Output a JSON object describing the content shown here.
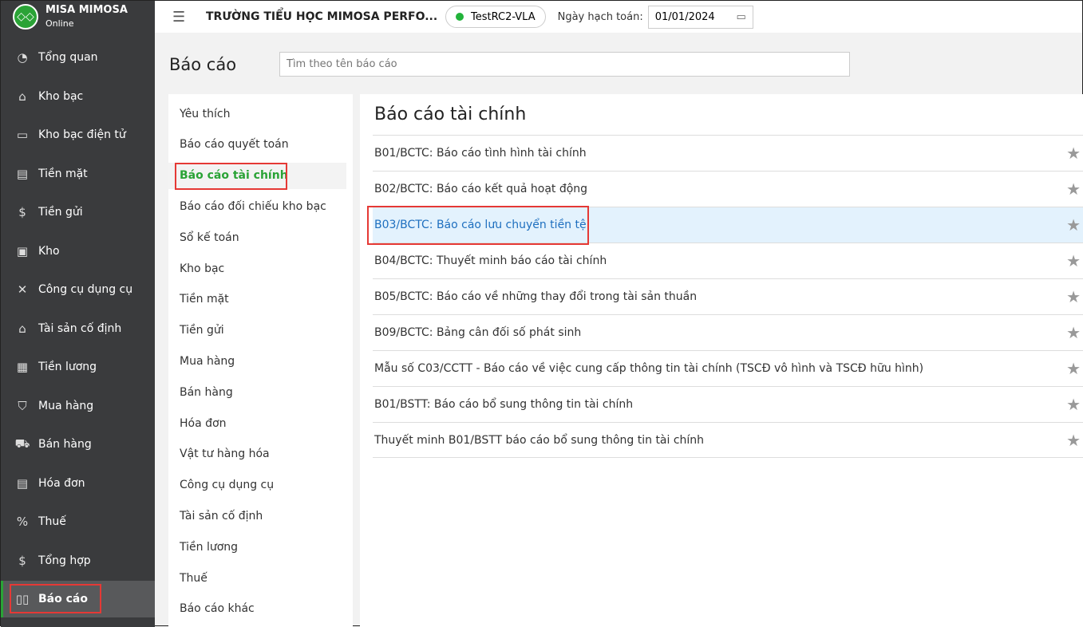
{
  "app": {
    "name": "MISA MIMOSA",
    "subtitle": "Online"
  },
  "sidebar": {
    "items": [
      {
        "label": "Tổng quan",
        "icon": "pie-chart-icon",
        "g": "◔"
      },
      {
        "label": "Kho bạc",
        "icon": "treasury-icon",
        "g": "⌂"
      },
      {
        "label": "Kho bạc điện tử",
        "icon": "monitor-icon",
        "g": "▭"
      },
      {
        "label": "Tiền mặt",
        "icon": "cash-icon",
        "g": "▤"
      },
      {
        "label": "Tiền gửi",
        "icon": "deposit-icon",
        "g": "$"
      },
      {
        "label": "Kho",
        "icon": "warehouse-icon",
        "g": "▣"
      },
      {
        "label": "Công cụ dụng cụ",
        "icon": "tools-icon",
        "g": "✕"
      },
      {
        "label": "Tài sản cố định",
        "icon": "asset-icon",
        "g": "⌂"
      },
      {
        "label": "Tiền lương",
        "icon": "salary-icon",
        "g": "▦"
      },
      {
        "label": "Mua hàng",
        "icon": "bag-icon",
        "g": "⛉"
      },
      {
        "label": "Bán hàng",
        "icon": "cart-icon",
        "g": "⛟"
      },
      {
        "label": "Hóa đơn",
        "icon": "invoice-icon",
        "g": "▤"
      },
      {
        "label": "Thuế",
        "icon": "tax-icon",
        "g": "%"
      },
      {
        "label": "Tổng hợp",
        "icon": "summary-icon",
        "g": "$"
      },
      {
        "label": "Báo cáo",
        "icon": "report-icon",
        "g": "▯▯"
      }
    ]
  },
  "topbar": {
    "org": "TRƯỜNG TIỂU HỌC MIMOSA PERFO...",
    "database": "TestRC2-VLA",
    "date_label": "Ngày hạch toán:",
    "date": "01/01/2024",
    "status_color": "#22b33a"
  },
  "page": {
    "title": "Báo cáo",
    "search_placeholder": "Tìm theo tên báo cáo"
  },
  "categories": [
    "Yêu thích",
    "Báo cáo quyết toán",
    "Báo cáo tài chính",
    "Báo cáo đối chiếu kho bạc",
    "Sổ kế toán",
    "Kho bạc",
    "Tiền mặt",
    "Tiền gửi",
    "Mua hàng",
    "Bán hàng",
    "Hóa đơn",
    "Vật tư hàng hóa",
    "Công cụ dụng cụ",
    "Tài sản cố định",
    "Tiền lương",
    "Thuế",
    "Báo cáo khác"
  ],
  "panel": {
    "title": "Báo cáo tài chính",
    "reports": [
      "B01/BCTC: Báo cáo tình hình tài chính",
      "B02/BCTC: Báo cáo kết quả hoạt động",
      "B03/BCTC: Báo cáo lưu chuyển tiền tệ",
      "B04/BCTC: Thuyết minh báo cáo tài chính",
      "B05/BCTC: Báo cáo về những thay đổi trong tài sản thuần",
      "B09/BCTC: Bảng cân đối số phát sinh",
      "Mẫu số C03/CCTT - Báo cáo về việc cung cấp thông tin tài chính (TSCĐ vô hình và TSCĐ hữu hình)",
      "B01/BSTT: Báo cáo bổ sung thông tin tài chính",
      "Thuyết minh B01/BSTT báo cáo bổ sung thông tin tài chính"
    ]
  }
}
